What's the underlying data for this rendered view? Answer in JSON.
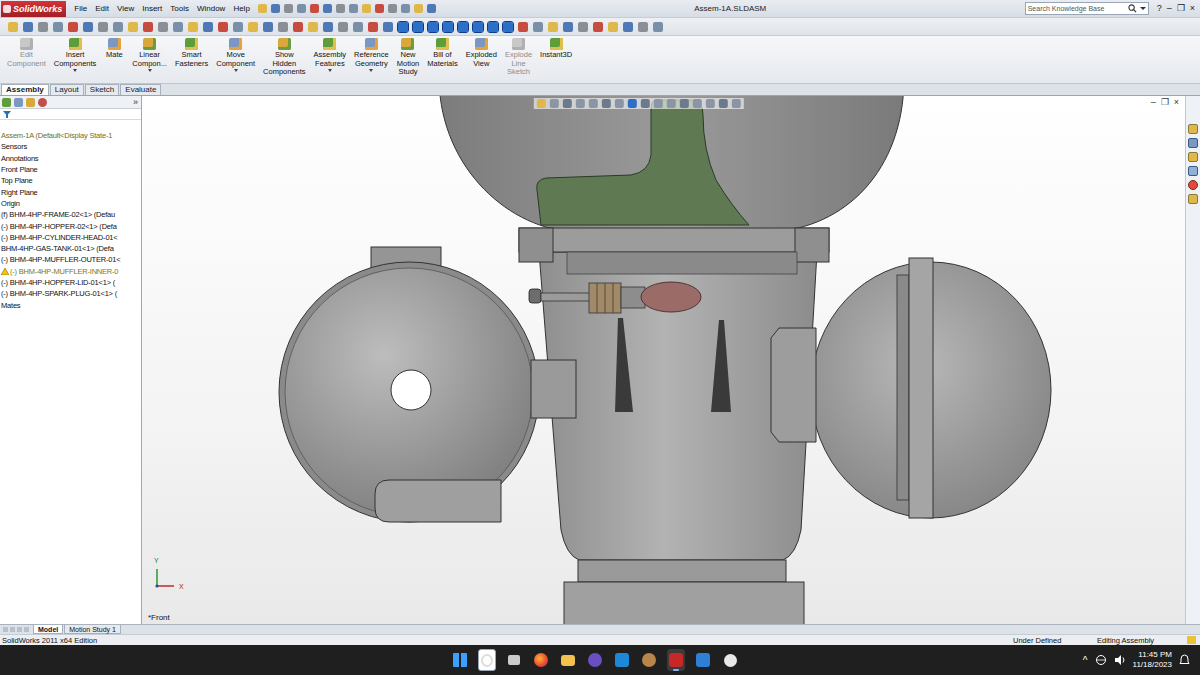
{
  "window": {
    "title": "Assem-1A.SLDASM",
    "logo": "SolidWorks",
    "controls": [
      "?",
      "–",
      "❐",
      "×"
    ]
  },
  "menu": [
    "File",
    "Edit",
    "View",
    "Insert",
    "Tools",
    "Window",
    "Help"
  ],
  "search": {
    "placeholder": "Search Knowledge Base"
  },
  "ribbon": [
    {
      "lines": [
        "Edit",
        "Component"
      ],
      "disabled": true,
      "dropdown": false
    },
    {
      "lines": [
        "Insert",
        "Components"
      ],
      "disabled": false,
      "dropdown": true
    },
    {
      "lines": [
        "Mate"
      ],
      "disabled": false,
      "dropdown": false
    },
    {
      "lines": [
        "Linear",
        "Compon..."
      ],
      "disabled": false,
      "dropdown": true
    },
    {
      "lines": [
        "Smart",
        "Fasteners"
      ],
      "disabled": false,
      "dropdown": false
    },
    {
      "lines": [
        "Move",
        "Component"
      ],
      "disabled": false,
      "dropdown": true
    },
    {
      "lines": [
        "Show",
        "Hidden",
        "Components"
      ],
      "disabled": false,
      "dropdown": false
    },
    {
      "lines": [
        "Assembly",
        "Features"
      ],
      "disabled": false,
      "dropdown": true
    },
    {
      "lines": [
        "Reference",
        "Geometry"
      ],
      "disabled": false,
      "dropdown": true
    },
    {
      "lines": [
        "New",
        "Motion",
        "Study"
      ],
      "disabled": false,
      "dropdown": false
    },
    {
      "lines": [
        "Bill of",
        "Materials"
      ],
      "disabled": false,
      "dropdown": false
    },
    {
      "lines": [
        "Exploded",
        "View"
      ],
      "disabled": false,
      "dropdown": false
    },
    {
      "lines": [
        "Explode",
        "Line",
        "Sketch"
      ],
      "disabled": true,
      "dropdown": false
    },
    {
      "lines": [
        "Instant3D"
      ],
      "disabled": false,
      "dropdown": false
    }
  ],
  "tabs": [
    {
      "label": "Assembly",
      "selected": true
    },
    {
      "label": "Layout",
      "selected": false
    },
    {
      "label": "Sketch",
      "selected": false
    },
    {
      "label": "Evaluate",
      "selected": false
    }
  ],
  "tree": {
    "more": "»",
    "items": [
      {
        "label": "Assem-1A  (Default<Display State-1",
        "kind": "root",
        "warning": false
      },
      {
        "label": "Sensors",
        "kind": "item",
        "warning": false
      },
      {
        "label": "Annotations",
        "kind": "item",
        "warning": false
      },
      {
        "label": "Front Plane",
        "kind": "item",
        "warning": false
      },
      {
        "label": "Top Plane",
        "kind": "item",
        "warning": false
      },
      {
        "label": "Right Plane",
        "kind": "item",
        "warning": false
      },
      {
        "label": "Origin",
        "kind": "item",
        "warning": false
      },
      {
        "label": "(f) BHM-4HP-FRAME-02<1> (Defau",
        "kind": "item",
        "warning": false
      },
      {
        "label": "(-) BHM-4HP-HOPPER-02<1> (Defa",
        "kind": "item",
        "warning": false
      },
      {
        "label": "(-) BHM-4HP-CYLINDER-HEAD-01<",
        "kind": "item",
        "warning": false
      },
      {
        "label": "BHM-4HP-GAS-TANK-01<1> (Defa",
        "kind": "item",
        "warning": false
      },
      {
        "label": "(-) BHM-4HP-MUFFLER-OUTER-01<",
        "kind": "item",
        "warning": false
      },
      {
        "label": "(-) BHM-4HP-MUFFLER-INNER-0",
        "kind": "item",
        "warning": true
      },
      {
        "label": "(-) BHM-4HP-HOPPER-LID-01<1> (",
        "kind": "item",
        "warning": false
      },
      {
        "label": "(-) BHM-4HP-SPARK-PLUG-01<1> (",
        "kind": "item",
        "warning": false
      },
      {
        "label": "Mates",
        "kind": "item",
        "warning": false
      }
    ]
  },
  "viewport": {
    "view_label": "*Front",
    "axis_x": "X",
    "axis_y": "Y",
    "controls": [
      "–",
      "❐",
      "×"
    ]
  },
  "bottom_tabs": [
    {
      "label": "Model",
      "selected": true
    },
    {
      "label": "Motion Study 1",
      "selected": false
    }
  ],
  "status_bar": {
    "edition": "SolidWorks 2011 x64 Edition",
    "state": "Under Defined",
    "mode": "Editing Assembly"
  },
  "taskbar": {
    "apps": [
      {
        "selected": false
      },
      {
        "selected": false
      },
      {
        "selected": false
      },
      {
        "selected": false
      },
      {
        "selected": false
      },
      {
        "selected": false
      },
      {
        "selected": false
      },
      {
        "selected": false
      },
      {
        "selected": true
      },
      {
        "selected": false
      },
      {
        "selected": false
      }
    ],
    "tray": "^",
    "time": "11:45 PM",
    "date": "11/18/2023"
  }
}
